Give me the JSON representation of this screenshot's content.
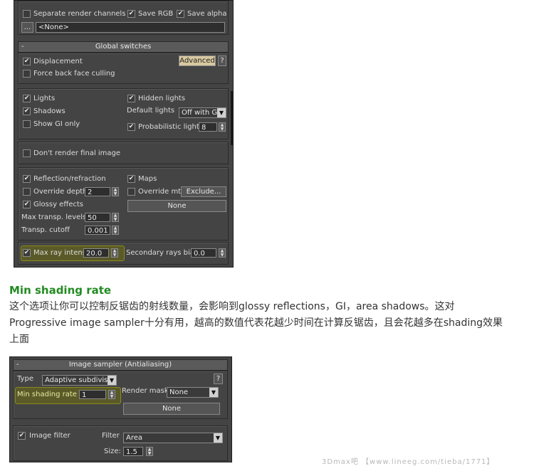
{
  "top_panel": {
    "render_channels": {
      "separate_label": "Separate render channels",
      "save_rgb": "Save RGB",
      "save_alpha": "Save alpha",
      "browse_btn": "...",
      "path_value": "<None>"
    },
    "global_switches": {
      "title": "Global switches",
      "collapse": "-",
      "displacement": "Displacement",
      "advanced_btn": "Advanced",
      "help_btn": "?",
      "force_back_face": "Force back face culling",
      "lights": "Lights",
      "hidden_lights": "Hidden lights",
      "shadows": "Shadows",
      "default_lights_label": "Default lights",
      "default_lights_value": "Off with GI",
      "show_gi_only": "Show GI only",
      "probabilistic_lights": "Probabilistic lights",
      "probabilistic_value": "8",
      "dont_render_final": "Don't render final image",
      "reflection_refraction": "Reflection/refraction",
      "maps": "Maps",
      "override_depth": "Override depth",
      "override_depth_value": "2",
      "override_mtl": "Override mtl",
      "exclude_btn": "Exclude...",
      "glossy_effects": "Glossy effects",
      "none_btn": "None",
      "max_transp_levels": "Max transp. levels",
      "max_transp_value": "50",
      "transp_cutoff": "Transp. cutoff",
      "transp_cutoff_value": "0.001",
      "max_ray_intens": "Max ray intens",
      "max_ray_value": "20.0",
      "secondary_rays_bias": "Secondary rays bias",
      "secondary_rays_value": "0.0"
    }
  },
  "article": {
    "heading": "Min shading rate",
    "line1": "这个选项让你可以控制反锯齿的射线数量，会影响到glossy reflections，GI，area shadows。这对",
    "line2": "Progressive image sampler十分有用，越高的数值代表花越少时间在计算反锯齿，且会花越多在shading效果",
    "line3": "上面"
  },
  "bottom_panel": {
    "title": "Image sampler (Antialiasing)",
    "collapse": "-",
    "type_label": "Type",
    "type_value": "Adaptive subdivision",
    "help_btn": "?",
    "min_shading_label": "Min shading rate",
    "min_shading_value": "1",
    "render_mask_label": "Render mask",
    "render_mask_value": "None",
    "none_btn": "None",
    "image_filter": "Image filter",
    "filter_label": "Filter",
    "filter_value": "Area",
    "size_label": "Size:",
    "size_value": "1.5"
  },
  "watermark": "3Dmax吧 【www.lineeg.com/tieba/1771】",
  "colors": {
    "heading": "#228b22",
    "highlight": "#8a8a1a",
    "panel": "#444444"
  },
  "icons": {
    "check": "check-icon",
    "dropdown": "chevron-down-icon",
    "spinner": "spinner-arrows-icon"
  }
}
